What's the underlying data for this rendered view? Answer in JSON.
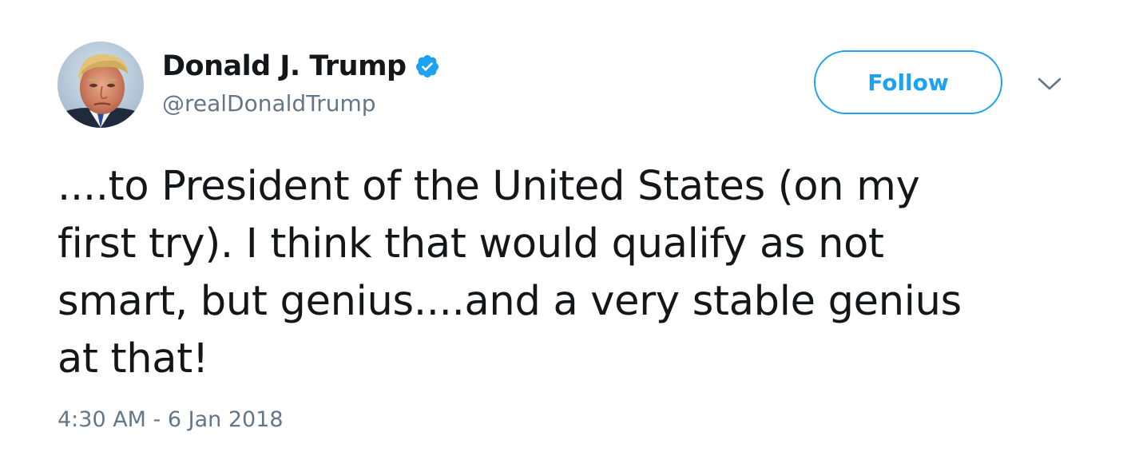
{
  "author": {
    "display_name": "Donald J. Trump",
    "handle": "@realDonaldTrump",
    "verified": true,
    "verified_icon": "verified-badge-icon",
    "avatar_icon": "profile-photo"
  },
  "actions": {
    "follow_label": "Follow",
    "more_icon": "chevron-down-icon"
  },
  "tweet": {
    "lines": [
      "....to President of the United States (on my",
      "first try). I think that would qualify as not",
      "smart, but genius....and a very stable genius",
      "at that!"
    ],
    "timestamp": "4:30 AM - 6 Jan 2018"
  },
  "colors": {
    "accent": "#1da1f2",
    "text": "#14171a",
    "secondary_text": "#657786",
    "background": "#ffffff"
  }
}
